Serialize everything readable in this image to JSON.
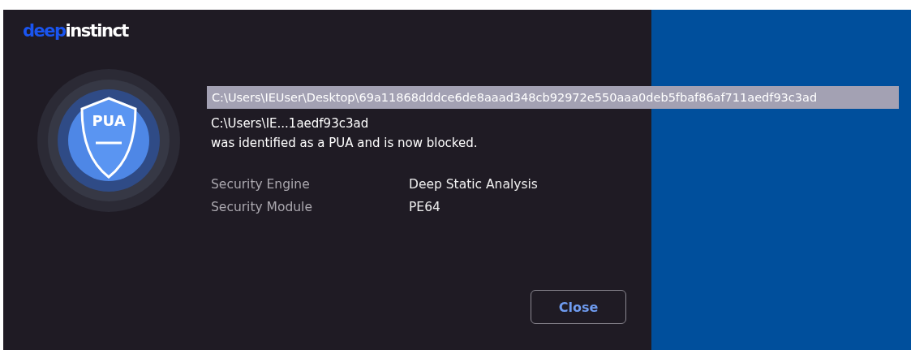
{
  "logo": {
    "brand_part": "deep",
    "rest": "instinct"
  },
  "badge": {
    "label": "PUA"
  },
  "tooltip": {
    "text": "C:\\Users\\IEUser\\Desktop\\69a11868dddce6de8aaad348cb92972e550aaa0deb5fbaf86af711aedf93c3ad"
  },
  "message": {
    "path": "C:\\Users\\IE...1aedf93c3ad",
    "text": "was identified as a PUA and is now blocked."
  },
  "details": [
    {
      "label": "Security Engine",
      "value": "Deep Static Analysis"
    },
    {
      "label": "Security Module",
      "value": "PE64"
    }
  ],
  "buttons": [
    "Close"
  ]
}
